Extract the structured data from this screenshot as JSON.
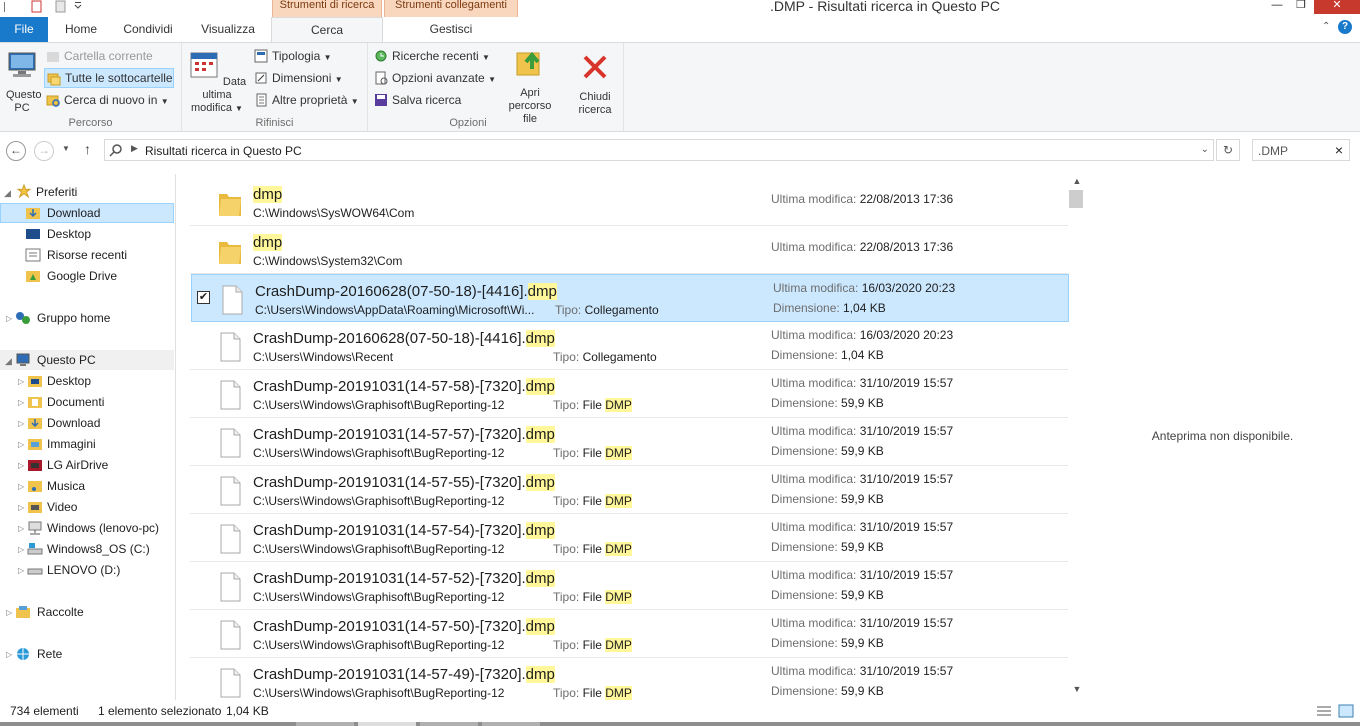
{
  "window": {
    "title": ".DMP - Risultati ricerca in Questo PC"
  },
  "context_groups": [
    "Strumenti di ricerca",
    "Strumenti collegamenti"
  ],
  "tabs": [
    {
      "label": "File"
    },
    {
      "label": "Home"
    },
    {
      "label": "Condividi"
    },
    {
      "label": "Visualizza"
    },
    {
      "label": "Cerca"
    },
    {
      "label": "Gestisci"
    }
  ],
  "ribbon": {
    "percorso": {
      "group_label": "Percorso",
      "questo_pc": "Questo PC",
      "cartella_corrente": "Cartella corrente",
      "tutte_sottocartelle": "Tutte le sottocartelle",
      "cerca_di_nuovo": "Cerca di nuovo in"
    },
    "rifinisci": {
      "group_label": "Rifinisci",
      "data_ultima_modifica": "Data ultima modifica",
      "tipologia": "Tipologia",
      "dimensioni": "Dimensioni",
      "altre_proprieta": "Altre proprietà"
    },
    "opzioni": {
      "group_label": "Opzioni",
      "ricerche_recenti": "Ricerche recenti",
      "opzioni_avanzate": "Opzioni avanzate",
      "salva_ricerca": "Salva ricerca",
      "apri_percorso": "Apri percorso file",
      "chiudi_ricerca": "Chiudi ricerca"
    }
  },
  "address": {
    "text": "Risultati ricerca in Questo PC",
    "search_value": ".DMP"
  },
  "nav": {
    "preferiti": "Preferiti",
    "download": "Download",
    "desktop": "Desktop",
    "risorse_recenti": "Risorse recenti",
    "google_drive": "Google Drive",
    "gruppo_home": "Gruppo home",
    "questo_pc": "Questo PC",
    "pc_desktop": "Desktop",
    "documenti": "Documenti",
    "pc_download": "Download",
    "immagini": "Immagini",
    "lg_airdrive": "LG AirDrive",
    "musica": "Musica",
    "video": "Video",
    "windows_lenovo": "Windows (lenovo-pc)",
    "windows8_os": "Windows8_OS (C:)",
    "lenovo_d": "LENOVO (D:)",
    "raccolte": "Raccolte",
    "rete": "Rete"
  },
  "labels": {
    "ultima_modifica": "Ultima modifica:",
    "dimensione": "Dimensione:",
    "tipo": "Tipo:"
  },
  "results": [
    {
      "name_pre": "",
      "name_hl": "dmp",
      "path": "C:\\Windows\\SysWOW64\\Com",
      "type_pre": "",
      "type_hl": "",
      "modified": "22/08/2013 17:36",
      "size": "",
      "icon": "folder-icon"
    },
    {
      "name_pre": "",
      "name_hl": "dmp",
      "path": "C:\\Windows\\System32\\Com",
      "type_pre": "",
      "type_hl": "",
      "modified": "22/08/2013 17:36",
      "size": "",
      "icon": "folder-icon"
    },
    {
      "name_pre": "CrashDump-20160628(07-50-18)-[4416].",
      "name_hl": "dmp",
      "path": "C:\\Users\\Windows\\AppData\\Roaming\\Microsoft\\Wi...",
      "type_pre": "Collegamento",
      "type_hl": "",
      "modified": "16/03/2020 20:23",
      "size": "1,04 KB",
      "icon": "file-icon",
      "selected": true
    },
    {
      "name_pre": "CrashDump-20160628(07-50-18)-[4416].",
      "name_hl": "dmp",
      "path": "C:\\Users\\Windows\\Recent",
      "type_pre": "Collegamento",
      "type_hl": "",
      "modified": "16/03/2020 20:23",
      "size": "1,04 KB",
      "icon": "file-icon"
    },
    {
      "name_pre": "CrashDump-20191031(14-57-58)-[7320].",
      "name_hl": "dmp",
      "path": "C:\\Users\\Windows\\Graphisoft\\BugReporting-12",
      "type_pre": "File ",
      "type_hl": "DMP",
      "modified": "31/10/2019 15:57",
      "size": "59,9 KB",
      "icon": "file-icon"
    },
    {
      "name_pre": "CrashDump-20191031(14-57-57)-[7320].",
      "name_hl": "dmp",
      "path": "C:\\Users\\Windows\\Graphisoft\\BugReporting-12",
      "type_pre": "File ",
      "type_hl": "DMP",
      "modified": "31/10/2019 15:57",
      "size": "59,9 KB",
      "icon": "file-icon"
    },
    {
      "name_pre": "CrashDump-20191031(14-57-55)-[7320].",
      "name_hl": "dmp",
      "path": "C:\\Users\\Windows\\Graphisoft\\BugReporting-12",
      "type_pre": "File ",
      "type_hl": "DMP",
      "modified": "31/10/2019 15:57",
      "size": "59,9 KB",
      "icon": "file-icon"
    },
    {
      "name_pre": "CrashDump-20191031(14-57-54)-[7320].",
      "name_hl": "dmp",
      "path": "C:\\Users\\Windows\\Graphisoft\\BugReporting-12",
      "type_pre": "File ",
      "type_hl": "DMP",
      "modified": "31/10/2019 15:57",
      "size": "59,9 KB",
      "icon": "file-icon"
    },
    {
      "name_pre": "CrashDump-20191031(14-57-52)-[7320].",
      "name_hl": "dmp",
      "path": "C:\\Users\\Windows\\Graphisoft\\BugReporting-12",
      "type_pre": "File ",
      "type_hl": "DMP",
      "modified": "31/10/2019 15:57",
      "size": "59,9 KB",
      "icon": "file-icon"
    },
    {
      "name_pre": "CrashDump-20191031(14-57-50)-[7320].",
      "name_hl": "dmp",
      "path": "C:\\Users\\Windows\\Graphisoft\\BugReporting-12",
      "type_pre": "File ",
      "type_hl": "DMP",
      "modified": "31/10/2019 15:57",
      "size": "59,9 KB",
      "icon": "file-icon"
    },
    {
      "name_pre": "CrashDump-20191031(14-57-49)-[7320].",
      "name_hl": "dmp",
      "path": "C:\\Users\\Windows\\Graphisoft\\BugReporting-12",
      "type_pre": "File ",
      "type_hl": "DMP",
      "modified": "31/10/2019 15:57",
      "size": "59,9 KB",
      "icon": "file-icon"
    }
  ],
  "preview": {
    "text": "Anteprima non disponibile."
  },
  "status": {
    "count": "734 elementi",
    "selection": "1 elemento selezionato",
    "size": "1,04 KB"
  },
  "colors": {
    "accent": "#1979ca",
    "selection": "#cce8ff",
    "highlight": "#fff799",
    "context_tab": "#f9d7bf",
    "close": "#c7382d"
  }
}
